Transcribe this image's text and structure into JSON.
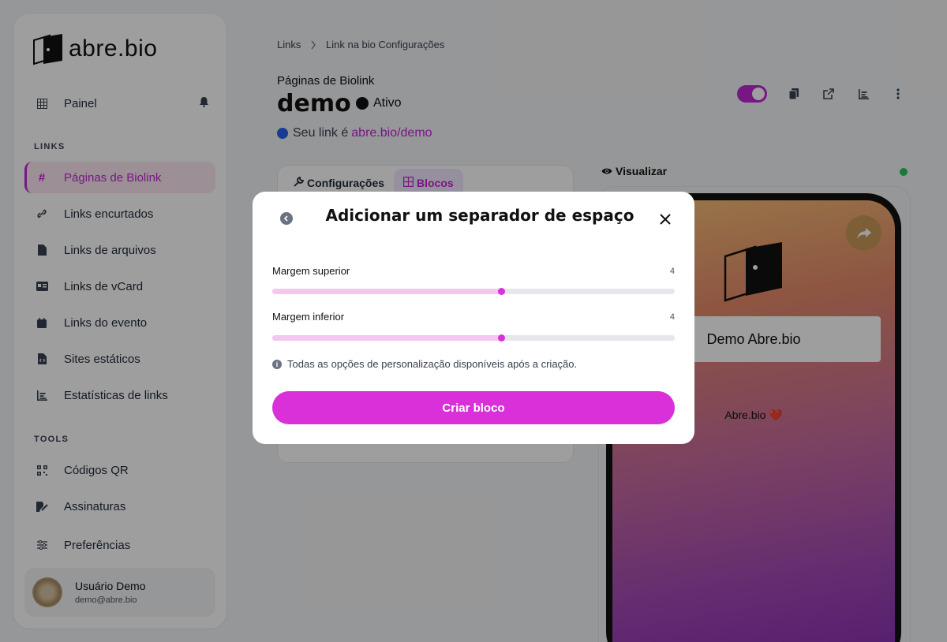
{
  "brand": {
    "name": "abre.bio",
    "accent": "#d930d9"
  },
  "sidebar": {
    "dashboard": {
      "label": "Painel",
      "icon": "grid-icon"
    },
    "section_links": "LINKS",
    "items": [
      {
        "label": "Páginas de Biolink",
        "icon": "hash-icon",
        "active": true
      },
      {
        "label": "Links encurtados",
        "icon": "link-icon"
      },
      {
        "label": "Links de arquivos",
        "icon": "file-icon"
      },
      {
        "label": "Links de vCard",
        "icon": "id-card-icon"
      },
      {
        "label": "Links do evento",
        "icon": "calendar-icon"
      },
      {
        "label": "Sites estáticos",
        "icon": "code-file-icon"
      },
      {
        "label": "Estatísticas de links",
        "icon": "bar-chart-icon"
      }
    ],
    "section_tools": "TOOLS",
    "tools": [
      {
        "label": "Códigos QR",
        "icon": "qr-icon"
      },
      {
        "label": "Assinaturas",
        "icon": "signature-icon"
      },
      {
        "label": "Preferências",
        "icon": "sliders-icon"
      }
    ],
    "user": {
      "name": "Usuário Demo",
      "email": "demo@abre.bio"
    }
  },
  "breadcrumb": {
    "first": "Links",
    "second": "Link na bio Configurações"
  },
  "page": {
    "subtitle": "Páginas de Biolink",
    "title": "demo",
    "status": "Ativo",
    "link_prefix": "Seu link é",
    "link_url": "abre.bio/demo"
  },
  "tabs": [
    {
      "label": "Configurações",
      "icon": "wrench-icon"
    },
    {
      "label": "Blocos",
      "icon": "blocks-icon",
      "active": true
    }
  ],
  "preview": {
    "label": "Visualizar",
    "button": "Demo Abre.bio",
    "footer": "Abre.bio ❤️"
  },
  "modal": {
    "title": "Adicionar um separador de espaço",
    "fields": [
      {
        "label": "Margem superior",
        "value": "4",
        "fraction": 0.57
      },
      {
        "label": "Margem inferior",
        "value": "4",
        "fraction": 0.57
      }
    ],
    "hint": "Todas as opções de personalização disponíveis após a criação.",
    "submit": "Criar bloco"
  }
}
